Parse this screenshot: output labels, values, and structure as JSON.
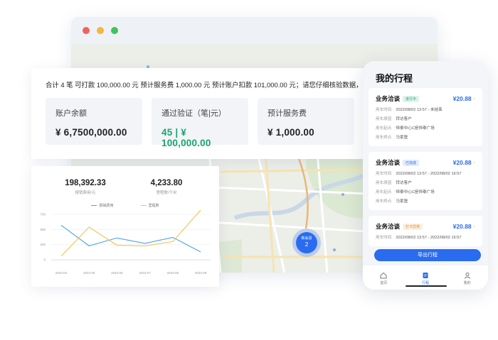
{
  "summary": {
    "line": "合计 4 笔   可打款 100,000.00 元   预计服务费 1,000.00 元   预计账户扣款 101,000.00 元；请您仔细核验数据，确认无误后",
    "cards": [
      {
        "label": "账户余额",
        "value": "¥ 6,7500,000.00"
      },
      {
        "label": "通过验证（笔|元）",
        "value": "45 | ¥ 100,000.00"
      },
      {
        "label": "预计服务费",
        "value": "¥ 1,000.00"
      }
    ]
  },
  "map": {
    "cluster_label": "新会县",
    "cluster_count": "2"
  },
  "stats": [
    {
      "value": "198,392.33",
      "caption": "报销费用/元"
    },
    {
      "value": "4,233.80",
      "caption": "里程数/千米"
    }
  ],
  "chart_data": {
    "type": "line",
    "categories": [
      "2023-04",
      "2023-05",
      "2023-06",
      "2023-07",
      "2023-08",
      "2023-09"
    ],
    "series": [
      {
        "name": "报销费用",
        "color": "#4aa3e8",
        "values": [
          570,
          230,
          360,
          270,
          370,
          130
        ]
      },
      {
        "name": "里程数",
        "color": "#f2c14b",
        "values": [
          60,
          540,
          240,
          230,
          300,
          820
        ]
      }
    ],
    "ylim": [
      0,
      750
    ],
    "yticks": [
      "750",
      "500",
      "250",
      "0"
    ],
    "grid": true,
    "legend": "top"
  },
  "phone": {
    "title": "我的行程",
    "trips": [
      {
        "title": "业务洽谈",
        "tag": "进行中",
        "tag_color": "#1aa56b",
        "price": "¥20.88",
        "rows": [
          [
            "用车时间",
            "2022/08/02 13:57 - 未结束"
          ],
          [
            "用车原因",
            "拜访客户"
          ],
          [
            "用车起点",
            "恒泰中心C座恒泰广场"
          ],
          [
            "用车终点",
            "马家堡"
          ]
        ]
      },
      {
        "title": "业务洽谈",
        "tag": "已完成",
        "tag_color": "#2a6cf0",
        "price": "¥20.88",
        "rows": [
          [
            "用车时间",
            "2022/08/02 13:57 - 2022/08/02 16:57"
          ],
          [
            "用车原因",
            "拜访客户"
          ],
          [
            "用车起点",
            "恒泰中心C座恒泰广场"
          ],
          [
            "用车终点",
            "马家堡"
          ]
        ]
      },
      {
        "title": "业务洽谈",
        "tag": "打卡异常",
        "tag_color": "#e08a1e",
        "price": "¥20.88",
        "rows": [
          [
            "用车时间",
            "2022/08/02 13:57 - 2022/08/02 16:57"
          ]
        ]
      }
    ],
    "export_label": "导出行程",
    "tabs": [
      {
        "label": "首页",
        "icon": "home-icon"
      },
      {
        "label": "行程",
        "icon": "trip-icon"
      },
      {
        "label": "我的",
        "icon": "user-icon"
      }
    ]
  }
}
